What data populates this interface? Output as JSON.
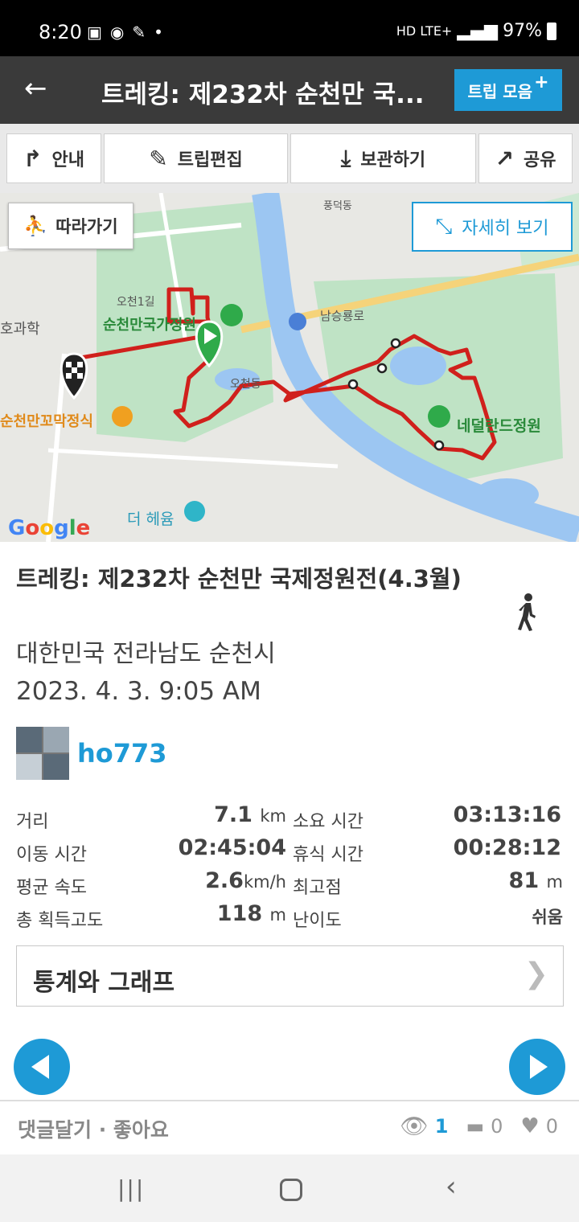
{
  "status_bar": {
    "time": "8:20",
    "network": "HD LTE+",
    "battery": "97%"
  },
  "header": {
    "title": "트레킹: 제232차 순천만 국...",
    "trip_button": "트립 모음"
  },
  "toolbar": {
    "guide": "안내",
    "edit": "트립편집",
    "save": "보관하기",
    "share": "공유"
  },
  "map": {
    "follow_button": "따라가기",
    "detail_button": "자세히 보기",
    "labels": [
      "순천만국가정원",
      "순천만꼬막정식",
      "네덜란드정원",
      "남승룡로",
      "오천동",
      "더 헤윰",
      "호과학",
      "풍덕동",
      "오천1길"
    ],
    "google": "Google",
    "route_color": "#d0201c"
  },
  "trip": {
    "title": "트레킹: 제232차 순천만 국제정원전(4.3월)",
    "location": "대한민국 전라남도 순천시",
    "datetime": "2023. 4. 3. 9:05 AM",
    "user": "ho773",
    "activity_icon": "walking-icon"
  },
  "stats": {
    "distance_label": "거리",
    "distance_value": "7.1",
    "distance_unit": "km",
    "duration_label": "소요 시간",
    "duration_value": "03:13:16",
    "moving_label": "이동 시간",
    "moving_value": "02:45:04",
    "rest_label": "휴식 시간",
    "rest_value": "00:28:12",
    "avg_speed_label": "평균 속도",
    "avg_speed_value": "2.6",
    "avg_speed_unit": "km/h",
    "max_alt_label": "최고점",
    "max_alt_value": "81",
    "max_alt_unit": "m",
    "gain_label": "총 획득고도",
    "gain_value": "118",
    "gain_unit": "m",
    "difficulty_label": "난이도",
    "difficulty_value": "쉬움"
  },
  "stats_button": {
    "label": "통계와 그래프"
  },
  "footer": {
    "social": "댓글달기 · 좋아요",
    "views": "1",
    "comments": "0",
    "likes": "0"
  },
  "colors": {
    "accent": "#1e9ad6",
    "app_bar": "#3a3a3a"
  }
}
